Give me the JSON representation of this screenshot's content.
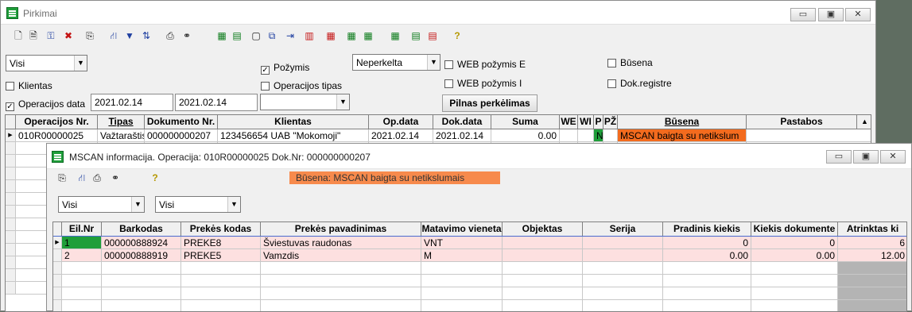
{
  "main_window": {
    "title": "Pirkimai",
    "title_buttons": [
      "▭",
      "▣",
      "✕"
    ],
    "toolbar_icons": [
      {
        "name": "new-doc-icon",
        "glyph": "🗋",
        "c": ""
      },
      {
        "name": "doc-icon",
        "glyph": "🗎",
        "c": ""
      },
      {
        "name": "tree-icon",
        "glyph": "⚿",
        "c": "b"
      },
      {
        "name": "delete-icon",
        "glyph": "✖",
        "c": "r"
      },
      {
        "name": "copy-icon",
        "glyph": "⎘",
        "c": ""
      },
      {
        "name": "hierarchy-icon",
        "glyph": "⛙",
        "c": "b"
      },
      {
        "name": "filter-icon",
        "glyph": "▼",
        "c": "b"
      },
      {
        "name": "sort-icon",
        "glyph": "⇅",
        "c": "b"
      },
      {
        "name": "print-icon",
        "glyph": "⎙",
        "c": ""
      },
      {
        "name": "binoculars-icon",
        "glyph": "⚭",
        "c": ""
      },
      {
        "name": "import-icon",
        "glyph": "▦",
        "c": "g"
      },
      {
        "name": "add-row-icon",
        "glyph": "▤",
        "c": "g"
      },
      {
        "name": "page-icon",
        "glyph": "▢",
        "c": ""
      },
      {
        "name": "link-icon",
        "glyph": "⧉",
        "c": "b"
      },
      {
        "name": "insert-icon",
        "glyph": "⇥",
        "c": "b"
      },
      {
        "name": "table-icon",
        "glyph": "▥",
        "c": "r"
      },
      {
        "name": "export-icon",
        "glyph": "▦",
        "c": "r"
      },
      {
        "name": "grid-green-icon",
        "glyph": "▦",
        "c": "g"
      },
      {
        "name": "grid-green2-icon",
        "glyph": "▦",
        "c": "g"
      },
      {
        "name": "grid-add-icon",
        "glyph": "▦",
        "c": "g"
      },
      {
        "name": "grid-edit-icon",
        "glyph": "▤",
        "c": "g"
      },
      {
        "name": "grid-remove-icon",
        "glyph": "▤",
        "c": "r"
      },
      {
        "name": "help-icon",
        "glyph": "?",
        "c": "y"
      }
    ],
    "filters": {
      "scope_select": "Visi",
      "klientas_label": "Klientas",
      "operacijos_data_label": "Operacijos data",
      "date_from": "2021.02.14",
      "date_to": "2021.02.14",
      "pozymis_label": "Požymis",
      "pozymis_select": "Neperkelta",
      "operacijos_tipas_label": "Operacijos tipas",
      "operacijos_tipas_select": "",
      "web_pozymis_e_label": "WEB požymis E",
      "web_pozymis_i_label": "WEB požymis I",
      "pilnas_button": "Pilnas perkėlimas",
      "busena_label": "Būsena",
      "dok_registre_label": "Dok.registre"
    },
    "grid": {
      "columns": [
        "Operacijos Nr.",
        "Tipas",
        "Dokumento Nr.",
        "Klientas",
        "Op.data",
        "Dok.data",
        "Suma",
        "WE",
        "WI",
        "P",
        "PŽ",
        "Būsena",
        "Pastabos"
      ],
      "rows": [
        {
          "op_nr": "010R00000025",
          "tipas": "Važtaraštis",
          "dok_nr": "000000000207",
          "klientas": "123456654  UAB \"Mokomoji\"",
          "op_data": "2021.02.14",
          "dok_data": "2021.02.14",
          "suma": "0.00",
          "we": "",
          "wi": "",
          "p": "N",
          "pz": "",
          "busena": "MSCAN baigta su netikslum",
          "pastabos": ""
        }
      ]
    }
  },
  "child_window": {
    "title": "MSCAN informacija. Operacija: 010R00000025 Dok.Nr: 000000000207",
    "title_buttons": [
      "▭",
      "▣",
      "✕"
    ],
    "status_badge": "Būsena: MSCAN baigta su netikslumais",
    "toolbar_icons": [
      {
        "name": "copy-icon",
        "glyph": "⎘",
        "c": ""
      },
      {
        "name": "hierarchy-icon",
        "glyph": "⛙",
        "c": "b"
      },
      {
        "name": "print-icon",
        "glyph": "⎙",
        "c": ""
      },
      {
        "name": "binoculars-icon",
        "glyph": "⚭",
        "c": ""
      },
      {
        "name": "help-icon",
        "glyph": "?",
        "c": "y"
      }
    ],
    "select_1": "Visi",
    "select_2": "Visi",
    "grid": {
      "columns": [
        "Eil.Nr",
        "Barkodas",
        "Prekės kodas",
        "Prekės pavadinimas",
        "Matavimo vieneta",
        "Objektas",
        "Serija",
        "Pradinis kiekis",
        "Kiekis dokumente",
        "Atrinktas ki"
      ],
      "rows": [
        {
          "eil": "1",
          "barkodas": "000000888924",
          "kodas": "PREKE8",
          "pav": "Šviestuvas raudonas",
          "mv": "VNT",
          "obj": "",
          "serija": "",
          "pradinis": "0",
          "kiekis_dok": "0",
          "atrinktas": "6"
        },
        {
          "eil": "2",
          "barkodas": "000000888919",
          "kodas": "PREKE5",
          "pav": "Vamzdis",
          "mv": "M",
          "obj": "",
          "serija": "",
          "pradinis": "0.00",
          "kiekis_dok": "0.00",
          "atrinktas": "12.00"
        }
      ]
    }
  },
  "colors": {
    "row_pink": "#fde0e0",
    "status_orange": "#f78a4c",
    "busena_cell": "#f36b1e",
    "selected_green": "#1f9e3a"
  }
}
